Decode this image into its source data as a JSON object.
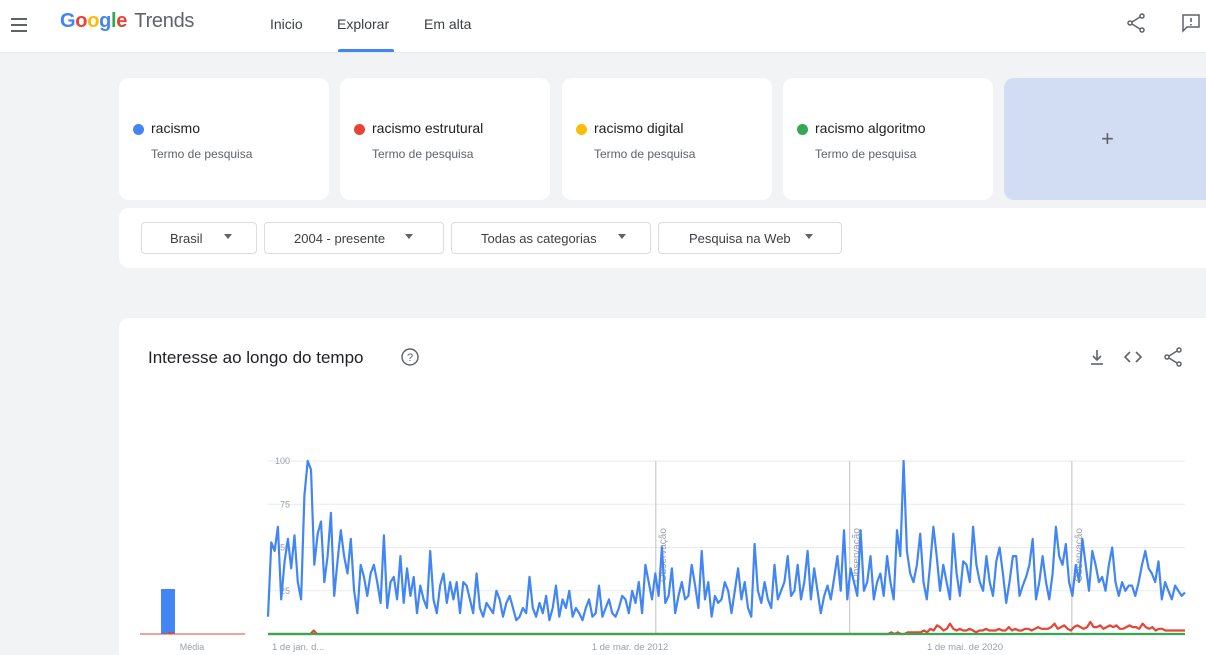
{
  "header": {
    "logo_google": "Google",
    "logo_trends": "Trends",
    "nav": [
      "Inicio",
      "Explorar",
      "Em alta"
    ],
    "active_nav": "Explorar"
  },
  "terms": [
    {
      "name": "racismo",
      "type": "Termo de pesquisa",
      "color": "#4285f4"
    },
    {
      "name": "racismo estrutural",
      "type": "Termo de pesquisa",
      "color": "#ea4335"
    },
    {
      "name": "racismo digital",
      "type": "Termo de pesquisa",
      "color": "#fbbc04"
    },
    {
      "name": "racismo algoritmo",
      "type": "Termo de pesquisa",
      "color": "#34a853"
    }
  ],
  "add_term_label": "+",
  "filters": {
    "region": "Brasil",
    "period": "2004 - presente",
    "category": "Todas as categorias",
    "search_type": "Pesquisa na Web"
  },
  "chart_section": {
    "title": "Interesse ao longo do tempo"
  },
  "icons": {
    "menu": "menu-icon",
    "share": "share-icon",
    "feedback": "feedback-icon",
    "help": "help-icon",
    "download": "download-icon",
    "embed": "embed-icon"
  },
  "chart_data": {
    "type": "line",
    "ylim": [
      0,
      100
    ],
    "yticks": [
      0,
      25,
      50,
      75,
      100
    ],
    "x_tick_labels": [
      "1 de jan. d...",
      "1 de mar. de 2012",
      "1 de mai. de 2020"
    ],
    "average_label": "Média",
    "averages": [
      {
        "name": "racismo",
        "value": 26
      },
      {
        "name": "racismo estrutural",
        "value": 1
      },
      {
        "name": "racismo digital",
        "value": 0
      },
      {
        "name": "racismo algoritmo",
        "value": 0
      }
    ],
    "annotation_label": "Observação",
    "annotation_dates": [
      "2012-01",
      "2016-01",
      "2020-08"
    ],
    "x_start": "2004-01",
    "x_end": "2022-12",
    "series": [
      {
        "name": "racismo",
        "color": "#4285f4",
        "values": [
          10,
          53,
          48,
          62,
          20,
          42,
          55,
          38,
          57,
          30,
          20,
          80,
          100,
          95,
          40,
          58,
          65,
          30,
          45,
          70,
          22,
          42,
          60,
          45,
          35,
          55,
          25,
          12,
          40,
          33,
          22,
          35,
          40,
          30,
          18,
          57,
          15,
          30,
          33,
          20,
          45,
          18,
          38,
          22,
          33,
          12,
          28,
          20,
          15,
          48,
          20,
          12,
          28,
          35,
          18,
          30,
          20,
          30,
          12,
          30,
          28,
          20,
          12,
          35,
          15,
          10,
          18,
          15,
          12,
          25,
          20,
          10,
          18,
          22,
          15,
          8,
          10,
          15,
          12,
          33,
          15,
          10,
          18,
          12,
          22,
          8,
          15,
          28,
          10,
          20,
          15,
          25,
          10,
          15,
          12,
          8,
          15,
          20,
          10,
          12,
          28,
          10,
          15,
          20,
          12,
          10,
          15,
          22,
          20,
          12,
          25,
          18,
          30,
          12,
          40,
          30,
          20,
          35,
          22,
          50,
          18,
          22,
          38,
          12,
          22,
          30,
          20,
          22,
          40,
          28,
          15,
          48,
          20,
          30,
          10,
          22,
          18,
          20,
          30,
          25,
          12,
          25,
          38,
          20,
          30,
          15,
          10,
          52,
          25,
          18,
          30,
          20,
          15,
          40,
          20,
          25,
          30,
          45,
          22,
          25,
          40,
          20,
          30,
          48,
          20,
          38,
          25,
          12,
          22,
          28,
          20,
          32,
          45,
          25,
          60,
          20,
          38,
          30,
          22,
          60,
          25,
          30,
          45,
          20,
          30,
          35,
          22,
          45,
          30,
          20,
          60,
          45,
          100,
          48,
          35,
          30,
          40,
          58,
          30,
          20,
          40,
          62,
          45,
          25,
          40,
          30,
          20,
          58,
          35,
          22,
          42,
          40,
          30,
          62,
          40,
          30,
          25,
          45,
          30,
          22,
          42,
          50,
          35,
          18,
          30,
          45,
          45,
          22,
          28,
          33,
          40,
          55,
          20,
          30,
          45,
          30,
          20,
          35,
          62,
          45,
          40,
          52,
          30,
          22,
          40,
          30,
          55,
          40,
          25,
          48,
          40,
          30,
          33,
          25,
          40,
          50,
          30,
          22,
          30,
          25,
          28,
          28,
          22,
          30,
          40,
          48,
          38,
          35,
          30,
          42,
          20,
          30,
          25,
          20,
          28,
          25,
          22,
          24
        ]
      },
      {
        "name": "racismo estrutural",
        "color": "#ea4335",
        "values": [
          0,
          0,
          0,
          0,
          0,
          0,
          0,
          0,
          0,
          0,
          0,
          0,
          0,
          0,
          2,
          0,
          0,
          0,
          0,
          0,
          0,
          0,
          0,
          0,
          0,
          0,
          0,
          0,
          0,
          0,
          0,
          0,
          0,
          0,
          0,
          0,
          0,
          0,
          0,
          0,
          0,
          0,
          0,
          0,
          0,
          0,
          0,
          0,
          0,
          0,
          0,
          0,
          0,
          0,
          0,
          0,
          0,
          0,
          0,
          0,
          0,
          0,
          0,
          0,
          0,
          0,
          0,
          0,
          0,
          0,
          0,
          0,
          0,
          0,
          0,
          0,
          0,
          0,
          0,
          0,
          0,
          0,
          0,
          0,
          0,
          0,
          0,
          0,
          0,
          0,
          0,
          0,
          0,
          0,
          0,
          0,
          0,
          0,
          0,
          0,
          0,
          0,
          0,
          0,
          0,
          0,
          0,
          0,
          0,
          0,
          0,
          0,
          0,
          0,
          0,
          0,
          0,
          0,
          0,
          0,
          0,
          0,
          0,
          0,
          0,
          0,
          0,
          0,
          0,
          0,
          0,
          0,
          0,
          0,
          0,
          0,
          0,
          0,
          0,
          0,
          0,
          0,
          0,
          0,
          0,
          0,
          0,
          0,
          0,
          0,
          0,
          0,
          0,
          0,
          0,
          0,
          0,
          0,
          0,
          0,
          0,
          0,
          0,
          0,
          0,
          0,
          0,
          0,
          0,
          0,
          0,
          0,
          0,
          0,
          0,
          0,
          0,
          0,
          0,
          0,
          0,
          0,
          0,
          0,
          0,
          0,
          0,
          0,
          0,
          0,
          0,
          1,
          0,
          1,
          0,
          0,
          1,
          1,
          1,
          1,
          1,
          2,
          1,
          3,
          2,
          5,
          4,
          2,
          3,
          6,
          3,
          2,
          3,
          2,
          2,
          3,
          2,
          1,
          2,
          2,
          3,
          2,
          2,
          2,
          3,
          2,
          2,
          4,
          2,
          3,
          2,
          2,
          3,
          3,
          2,
          3,
          4,
          3,
          3,
          3,
          4,
          6,
          3,
          4,
          5,
          3,
          2,
          4,
          5,
          4,
          3,
          4,
          7,
          4,
          4,
          5,
          3,
          4,
          5,
          4,
          5,
          3,
          3,
          4,
          5,
          4,
          4,
          3,
          6,
          4,
          3,
          4,
          2,
          3,
          3,
          2,
          2,
          2,
          2,
          2,
          2,
          2
        ]
      },
      {
        "name": "racismo algoritmo",
        "color": "#34a853",
        "values_note": "",
        "values": [
          0
        ]
      }
    ]
  }
}
